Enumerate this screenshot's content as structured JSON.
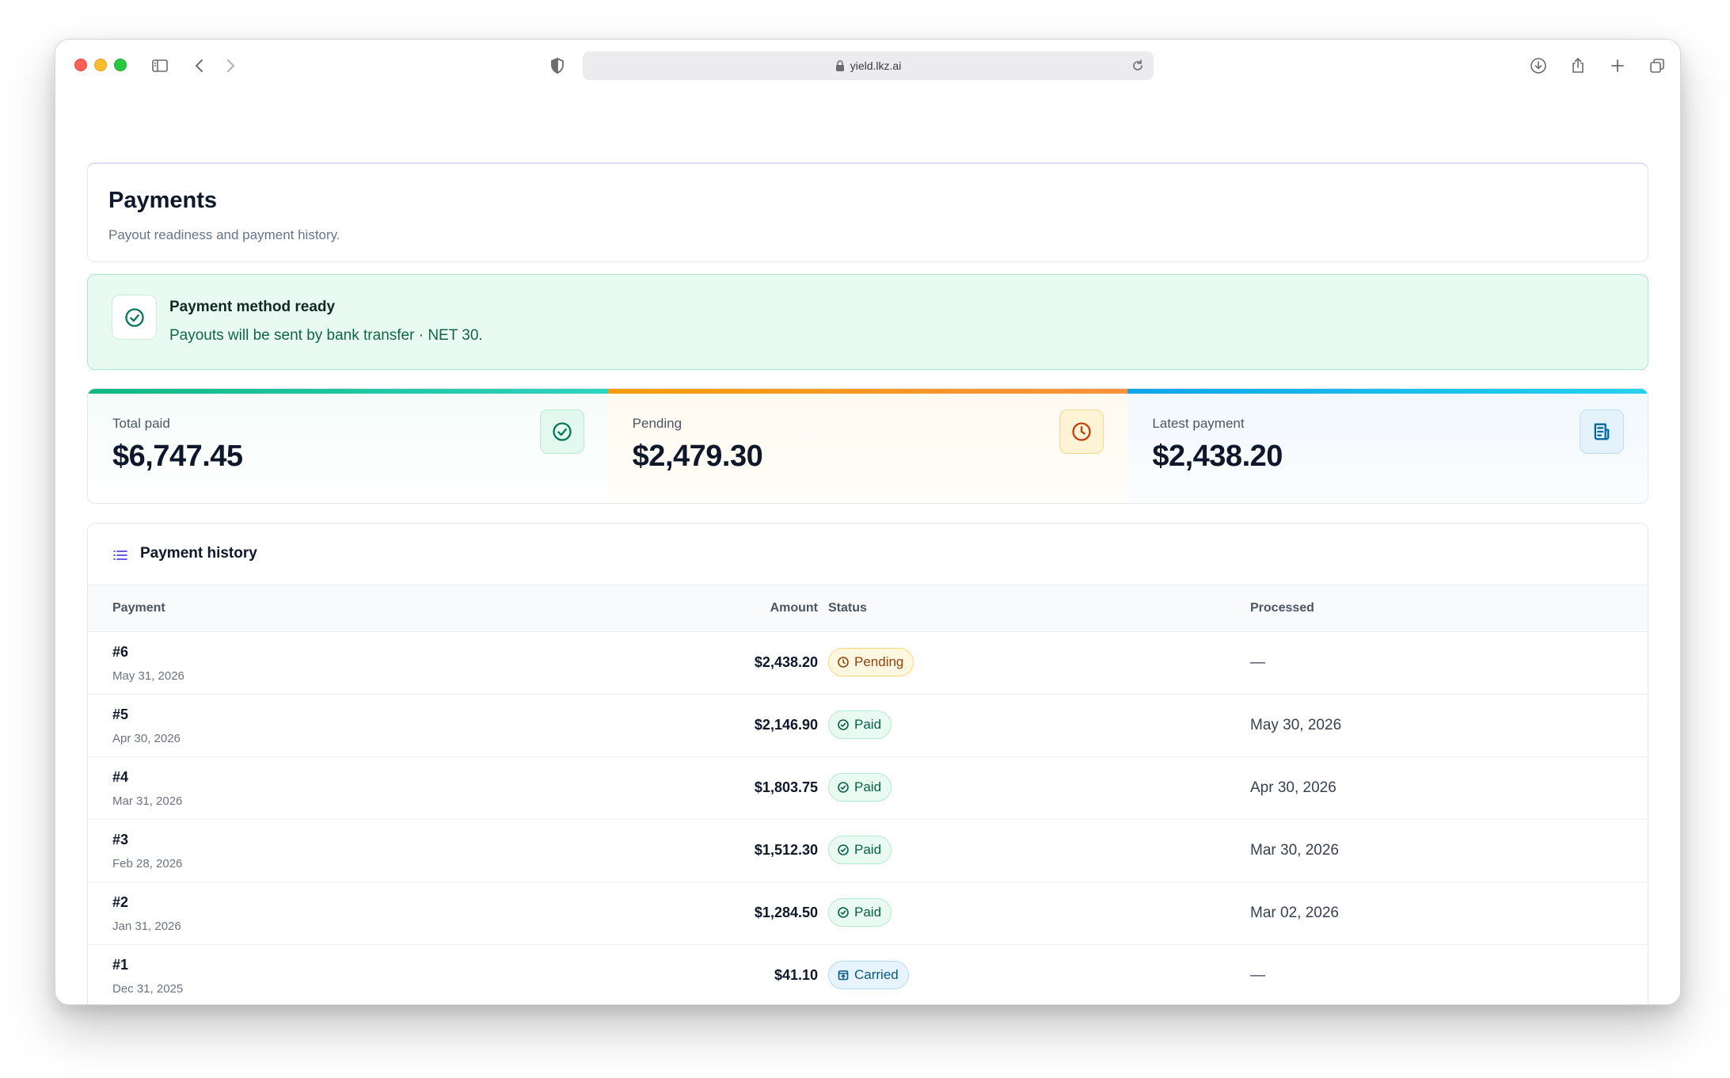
{
  "browser": {
    "url": "yield.lkz.ai"
  },
  "header": {
    "title": "Payments",
    "subtitle": "Payout readiness and payment history."
  },
  "alert": {
    "title": "Payment method ready",
    "text": "Payouts will be sent by bank transfer · NET 30."
  },
  "stats": [
    {
      "label": "Total paid",
      "value": "$6,747.45",
      "icon": "check-circle-icon"
    },
    {
      "label": "Pending",
      "value": "$2,479.30",
      "icon": "clock-icon"
    },
    {
      "label": "Latest payment",
      "value": "$2,438.20",
      "icon": "receipt-icon"
    }
  ],
  "history": {
    "title": "Payment history",
    "columns": {
      "payment": "Payment",
      "amount": "Amount",
      "status": "Status",
      "processed": "Processed"
    },
    "rows": [
      {
        "id": "#6",
        "date": "May 31, 2026",
        "amount": "$2,438.20",
        "status": "Pending",
        "processed": "—"
      },
      {
        "id": "#5",
        "date": "Apr 30, 2026",
        "amount": "$2,146.90",
        "status": "Paid",
        "processed": "May 30, 2026"
      },
      {
        "id": "#4",
        "date": "Mar 31, 2026",
        "amount": "$1,803.75",
        "status": "Paid",
        "processed": "Apr 30, 2026"
      },
      {
        "id": "#3",
        "date": "Feb 28, 2026",
        "amount": "$1,512.30",
        "status": "Paid",
        "processed": "Mar 30, 2026"
      },
      {
        "id": "#2",
        "date": "Jan 31, 2026",
        "amount": "$1,284.50",
        "status": "Paid",
        "processed": "Mar 02, 2026"
      },
      {
        "id": "#1",
        "date": "Dec 31, 2025",
        "amount": "$41.10",
        "status": "Carried",
        "processed": "—"
      }
    ]
  },
  "colors": {
    "success": "#047857",
    "pending": "#c2410c",
    "info": "#0369a1",
    "accent": "#4f46e5"
  }
}
